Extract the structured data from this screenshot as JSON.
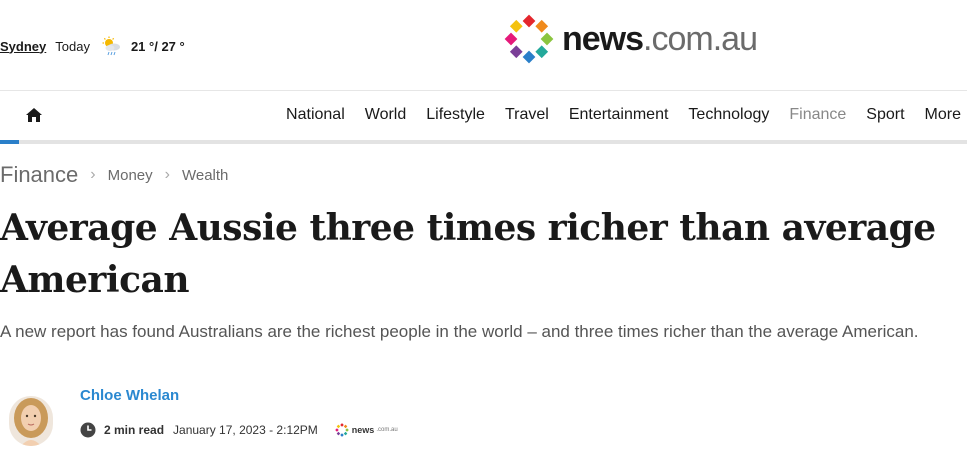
{
  "weather": {
    "city": "Sydney",
    "day": "Today",
    "icon": "partly-cloudy-icon",
    "temps": "21 °/ 27 °"
  },
  "logo": {
    "news": "news",
    "domain": ".com.au",
    "dot_colors": [
      "#e4262d",
      "#f08a1c",
      "#8bc53f",
      "#23a99b",
      "#2a7fc9",
      "#7b3f98",
      "#e5197a",
      "#f4c20d"
    ]
  },
  "nav": {
    "home_icon": "home-icon",
    "items": [
      {
        "label": "National"
      },
      {
        "label": "World"
      },
      {
        "label": "Lifestyle"
      },
      {
        "label": "Travel"
      },
      {
        "label": "Entertainment"
      },
      {
        "label": "Technology"
      },
      {
        "label": "Finance"
      },
      {
        "label": "Sport"
      },
      {
        "label": "More"
      }
    ],
    "active": "Finance",
    "accent_color": "#2a7fc9"
  },
  "breadcrumb": {
    "section": "Finance",
    "items": [
      "Money",
      "Wealth"
    ]
  },
  "article": {
    "headline": "Average Aussie three times richer than average American",
    "standfirst": "A new report has found Australians are the richest people in the world – and three times richer than the average American.",
    "author": "Chloe Whelan",
    "read_time": "2 min read",
    "date": "January 17, 2023 - 2:12PM",
    "source_icon": "news-com-au-logo-icon",
    "source_text": "news",
    "source_domain": ".com.au"
  }
}
